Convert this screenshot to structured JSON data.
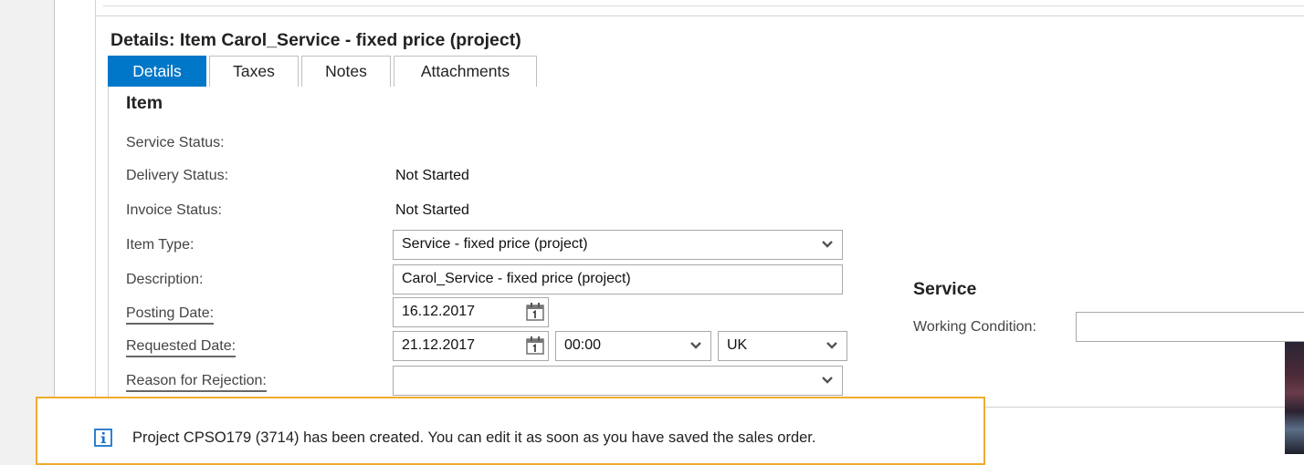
{
  "details": {
    "title": "Details: Item Carol_Service - fixed price (project)",
    "tabs": [
      {
        "label": "Details",
        "active": true
      },
      {
        "label": "Taxes",
        "active": false
      },
      {
        "label": "Notes",
        "active": false
      },
      {
        "label": "Attachments",
        "active": false
      }
    ]
  },
  "item": {
    "heading": "Item",
    "service_status_label": "Service Status:",
    "delivery_status_label": "Delivery Status:",
    "delivery_status_value": "Not Started",
    "invoice_status_label": "Invoice Status:",
    "invoice_status_value": "Not Started",
    "item_type_label": "Item Type:",
    "item_type_value": "Service - fixed price (project)",
    "description_label": "Description:",
    "description_value": "Carol_Service - fixed price (project)",
    "posting_date_label": "Posting Date:",
    "posting_date_value": "16.12.2017",
    "requested_date_label": "Requested Date:",
    "requested_date_value": "21.12.2017",
    "requested_time_value": "00:00",
    "requested_timezone_value": "UK",
    "reason_label": "Reason for Rejection:",
    "reason_value": ""
  },
  "service": {
    "heading": "Service",
    "working_condition_label": "Working Condition:",
    "working_condition_value": ""
  },
  "notification": {
    "icon": "info-icon",
    "message": "Project CPSO179 (3714) has been created. You can edit it as soon as you have saved the sales order."
  },
  "colors": {
    "active_tab": "#0077c8",
    "notice_border": "#f0ab2e",
    "info_icon": "#1a73c6"
  }
}
